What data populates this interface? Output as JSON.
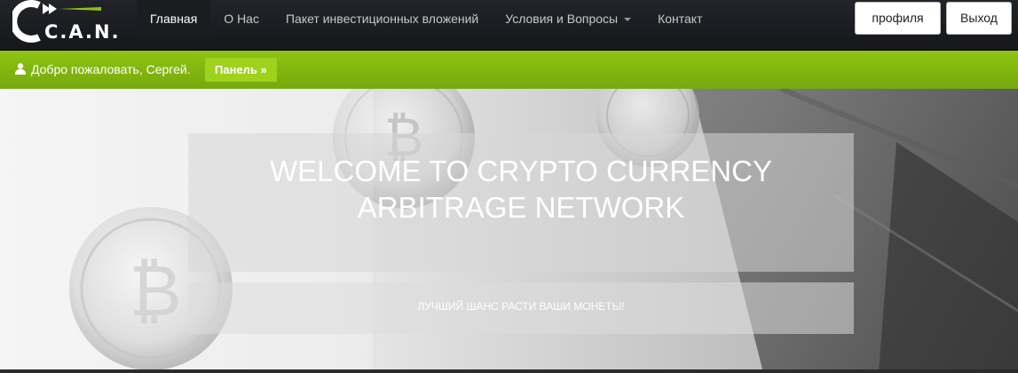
{
  "logo": {
    "text": "C.A.N.",
    "icon": "can-logo-icon"
  },
  "nav": {
    "items": [
      {
        "label": "Главная",
        "active": true
      },
      {
        "label": "О Нас",
        "active": false
      },
      {
        "label": "Пакет инвестиционных вложений",
        "active": false
      },
      {
        "label": "Условия и Вопросы",
        "active": false,
        "dropdown": true
      },
      {
        "label": "Контакт",
        "active": false
      }
    ],
    "profile_button": "профиля",
    "logout_button": "Выход"
  },
  "welcome_bar": {
    "icon": "user-icon",
    "greeting": "Добро пожаловать, Сергей.",
    "panel_button": "Панель »"
  },
  "hero": {
    "title": "WELCOME TO CRYPTO CURRENCY ARBITRAGE NETWORK",
    "subtitle": "ЛУЧШИЙ ШАНС РАСТИ ВАШИ МОНЕТЫ!"
  },
  "colors": {
    "navbar_bg": "#1b1d21",
    "accent_green": "#82b80f",
    "panel_button": "#9fd21c"
  }
}
